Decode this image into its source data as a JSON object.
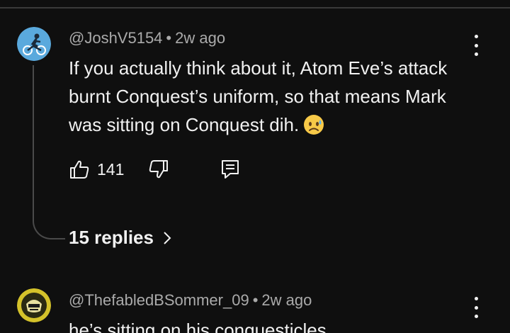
{
  "comments": [
    {
      "author": "@JoshV5154",
      "separator": "•",
      "time": "2w ago",
      "text": "If you actually think about it, Atom Eve’s attack burnt Conquest’s uniform, so that means Mark was sitting on Conquest dih.",
      "emoji": "sad-face-emoji",
      "likes": "141",
      "replies_label": "15 replies"
    },
    {
      "author": "@ThefabledBSommer_09",
      "separator": "•",
      "time": "2w ago",
      "text": "he’s sitting on his conquesticles"
    }
  ],
  "icons": {
    "like": "thumbs-up-icon",
    "dislike": "thumbs-down-icon",
    "reply": "comment-reply-icon",
    "more": "vertical-dots-icon",
    "chevron": "chevron-right-icon"
  },
  "colors": {
    "background": "#0f0f0f",
    "text": "#f1f1f1",
    "meta": "#aaaaaa",
    "thread_line": "#4a4a4a"
  }
}
